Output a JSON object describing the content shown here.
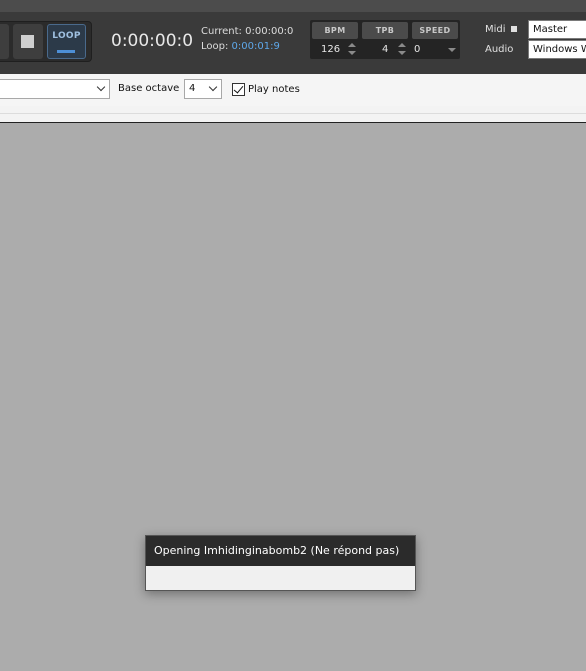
{
  "transport": {
    "loop_label": "LOOP",
    "time_display": "0:00:00:0",
    "current_label": "Current:",
    "current_value": "0:00:00:0",
    "loop_time_label": "Loop:",
    "loop_time_value": "0:00:01:9"
  },
  "params": {
    "bpm_label": "BPM",
    "bpm_value": "126",
    "tpb_label": "TPB",
    "tpb_value": "4",
    "speed_label": "SPEED",
    "speed_value": "0"
  },
  "io": {
    "midi_label": "Midi",
    "midi_value": "Master",
    "audio_label": "Audio",
    "audio_value": "Windows W"
  },
  "piano_bar": {
    "base_octave_label": "Base octave",
    "base_octave_value": "4",
    "play_notes_label": "Play notes",
    "play_notes_checked": true
  },
  "dialog": {
    "title": "Opening Imhidinginabomb2 (Ne répond pas)"
  },
  "colors": {
    "toolbar_bg": "#3a3a3a",
    "loop_accent": "#5ea8ea",
    "workspace_bg": "#acacac"
  }
}
